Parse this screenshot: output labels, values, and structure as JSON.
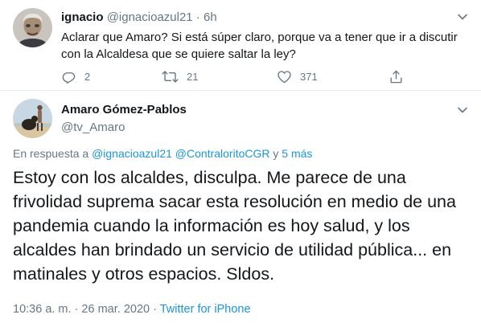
{
  "first_tweet": {
    "name": "ignacio",
    "handle": "@ignacioazul21",
    "separator": "·",
    "time": "6h",
    "text": "Aclarar que Amaro? Si está súper claro, porque va a tener que ir a discutir con la Alcaldesa que se quiere saltar la ley?",
    "actions": {
      "reply_count": "2",
      "retweet_count": "21",
      "like_count": "371"
    }
  },
  "main_tweet": {
    "name": "Amaro Gómez-Pablos",
    "handle": "@tv_Amaro",
    "replying_prefix": "En respuesta a",
    "replying_user1": "@ignacioazul21",
    "replying_user2": "@ContraloritoCGR",
    "replying_joiner": "y",
    "replying_more": "5 más",
    "text": "Estoy con los alcaldes, disculpa. Me parece de una frivolidad suprema sacar esta resolución en medio de una pandemia cuando la información es hoy salud, y los alcaldes han brindado un servicio de utilidad pública... en matinales y otros espacios. Sldos.",
    "timestamp": "10:36 a. m. · 26 mar. 2020",
    "meta_separator": "·",
    "source": "Twitter for iPhone"
  },
  "colors": {
    "text": "#14171a",
    "secondary": "#657786",
    "link": "#1b95e0",
    "divider": "#e6ecf0"
  },
  "icons": [
    "chevron-down-icon",
    "reply-icon",
    "retweet-icon",
    "like-icon",
    "share-icon"
  ]
}
